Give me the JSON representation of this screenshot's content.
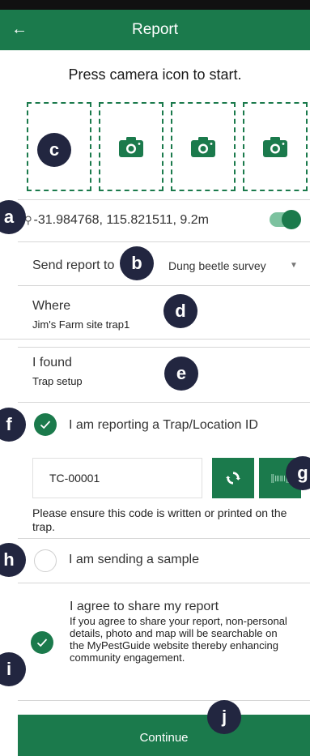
{
  "header": {
    "back_icon": "arrow-left-icon",
    "title": "Report"
  },
  "instruction": "Press camera icon to start.",
  "photos": {
    "icon": "camera-icon",
    "slot_count": 4
  },
  "location": {
    "pin_icon": "map-marker-icon",
    "coords": "-31.984768, 115.821511, 9.2m",
    "toggle_on": true
  },
  "send_report": {
    "label": "Send report to",
    "value": "Dung beetle survey"
  },
  "where": {
    "label": "Where",
    "value": "Jim's Farm site trap1"
  },
  "found": {
    "label": "I found",
    "value": "Trap setup"
  },
  "trap": {
    "label": "I am reporting a Trap/Location ID",
    "checked": true,
    "code": "TC-00001",
    "note": "Please ensure this code is written or printed on the trap.",
    "refresh_icon": "refresh-icon",
    "barcode_icon": "barcode-icon"
  },
  "sample": {
    "label": "I am sending a sample",
    "checked": false
  },
  "agree": {
    "title": "I agree to share my report",
    "description": "If you agree to share your report, non-personal details, photo and map will be searchable on the MyPestGuide website thereby enhancing community engagement.",
    "checked": true
  },
  "continue_label": "Continue",
  "callouts": {
    "a": "a",
    "b": "b",
    "c": "c",
    "d": "d",
    "e": "e",
    "f": "f",
    "g": "g",
    "h": "h",
    "i": "i",
    "j": "j"
  },
  "colors": {
    "brand_green": "#1b7a4c",
    "toggle_track": "#7cc29f",
    "callout_navy": "#222640"
  }
}
